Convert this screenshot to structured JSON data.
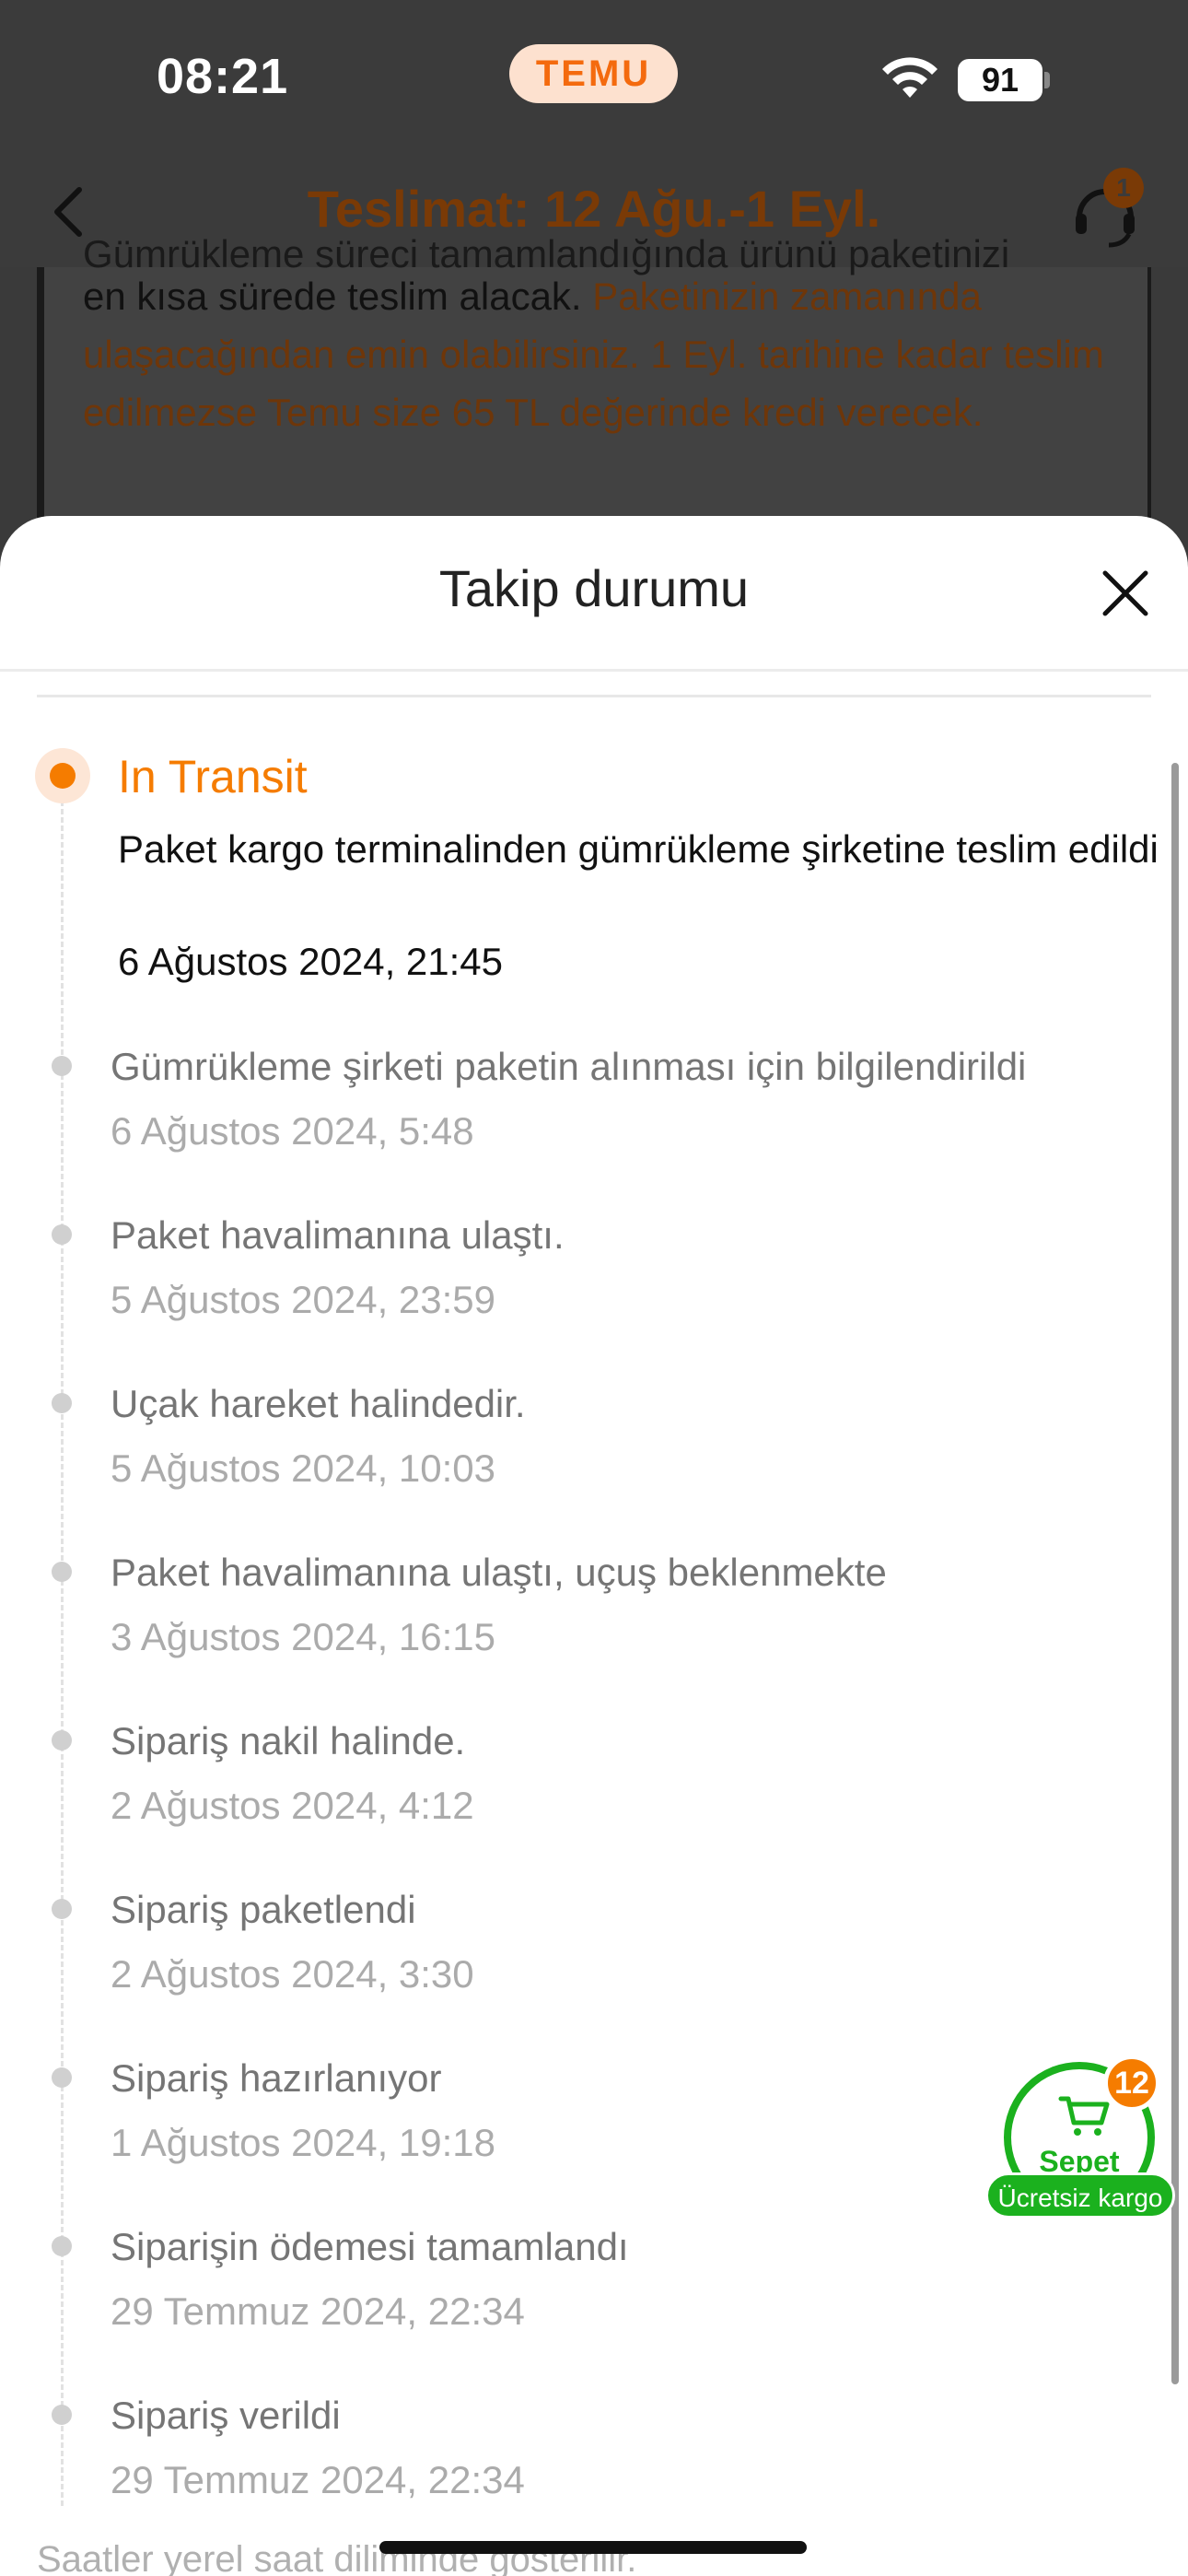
{
  "status_bar": {
    "time": "08:21",
    "brand": "TEMU",
    "battery": "91"
  },
  "header": {
    "title": "Teslimat: 12 Ağu.-1 Eyl.",
    "support_badge": "1"
  },
  "background": {
    "line0": "Gümrükleme süreci tamamlandığında ürünü paketinizi",
    "text_plain": "en kısa sürede teslim alacak. ",
    "text_orange": "Paketinizin zamanında ulaşacağından emin olabilirsiniz. 1 Eyl. tarihine kadar teslim edilmezse Temu size 65 TL değerinde kredi verecek."
  },
  "sheet": {
    "title": "Takip durumu",
    "current": {
      "status": "In Transit",
      "description": "Paket kargo terminalinden gümrükleme şirketine teslim edildi",
      "date": "6 Ağustos 2024, 21:45"
    },
    "events": [
      {
        "description": "Gümrükleme şirketi paketin alınması için bilgilendirildi",
        "date": "6 Ağustos 2024, 5:48"
      },
      {
        "description": "Paket havalimanına ulaştı.",
        "date": "5 Ağustos 2024, 23:59"
      },
      {
        "description": "Uçak hareket halindedir.",
        "date": "5 Ağustos 2024, 10:03"
      },
      {
        "description": "Paket havalimanına ulaştı, uçuş beklenmekte",
        "date": "3 Ağustos 2024, 16:15"
      },
      {
        "description": "Sipariş nakil halinde.",
        "date": "2 Ağustos 2024, 4:12"
      },
      {
        "description": "Sipariş paketlendi",
        "date": "2 Ağustos 2024, 3:30"
      },
      {
        "description": "Sipariş hazırlanıyor",
        "date": "1 Ağustos 2024, 19:18"
      },
      {
        "description": "Siparişin ödemesi tamamlandı",
        "date": "29 Temmuz 2024, 22:34"
      },
      {
        "description": "Sipariş verildi",
        "date": "29 Temmuz 2024, 22:34"
      }
    ],
    "footnote": "Saatler yerel saat diliminde gösterilir."
  },
  "cart": {
    "label": "Sepet",
    "count": "12",
    "free_shipping": "Ücretsiz kargo"
  },
  "colors": {
    "accent": "#f57c00",
    "cart_green": "#1bb11e"
  }
}
